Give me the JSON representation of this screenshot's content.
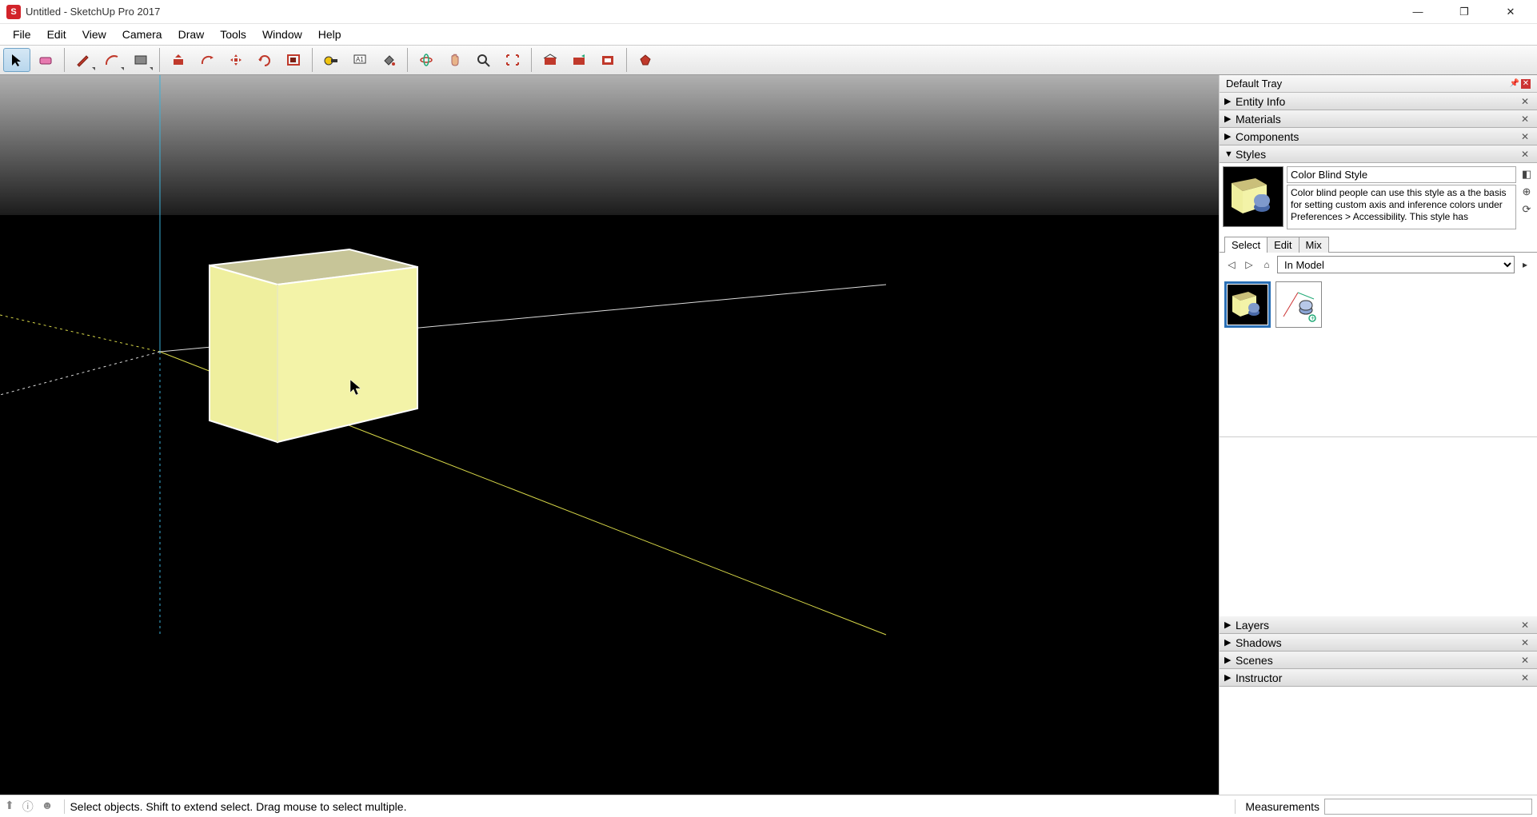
{
  "titlebar": {
    "text": "Untitled - SketchUp Pro 2017"
  },
  "menu": {
    "items": [
      "File",
      "Edit",
      "View",
      "Camera",
      "Draw",
      "Tools",
      "Window",
      "Help"
    ]
  },
  "toolbar_groups": [
    [
      "select",
      "eraser",
      "pencil",
      "arc",
      "rectangle"
    ],
    [
      "pushpull",
      "offset",
      "move",
      "rotate",
      "scale"
    ],
    [
      "tapemeasure",
      "text",
      "paintbucket"
    ],
    [
      "orbit",
      "pan",
      "zoom",
      "zoomextents"
    ],
    [
      "warehouse1",
      "warehouse2",
      "extensions",
      "ruby"
    ]
  ],
  "tray": {
    "title": "Default Tray",
    "panels_top": [
      "Entity Info",
      "Materials",
      "Components"
    ],
    "styles_panel": {
      "title": "Styles",
      "style_name": "Color Blind Style",
      "style_desc": "Color blind people can use this style as a the basis for setting custom axis and inference colors under Preferences > Accessibility.  This style has",
      "tabs": [
        "Select",
        "Edit",
        "Mix"
      ],
      "active_tab": "Select",
      "location": "In Model"
    },
    "panels_bottom": [
      "Layers",
      "Shadows",
      "Scenes",
      "Instructor"
    ]
  },
  "statusbar": {
    "hint": "Select objects. Shift to extend select. Drag mouse to select multiple.",
    "measurements_label": "Measurements"
  }
}
